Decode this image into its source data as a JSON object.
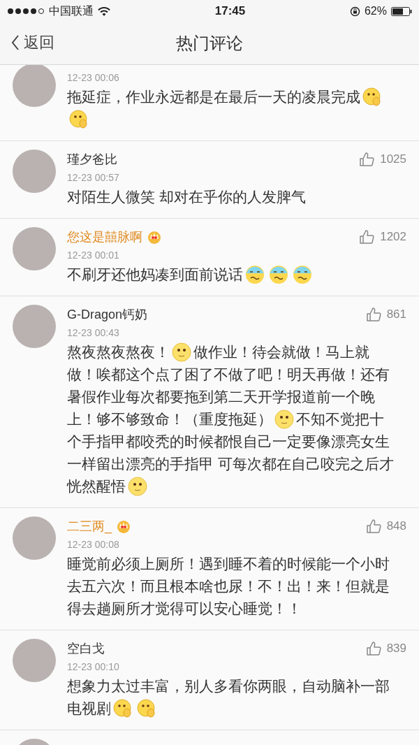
{
  "status_bar": {
    "carrier": "中国联通",
    "time": "17:45",
    "battery": "62%"
  },
  "nav": {
    "back": "返回",
    "title": "热门评论"
  },
  "comments": [
    {
      "time": "12-23 00:06",
      "lines": [
        [
          {
            "kind": "text",
            "text": "拖延症，作业永远都是在最后一天的凌晨完成"
          },
          {
            "kind": "covermouth"
          }
        ],
        [
          {
            "kind": "covermouth"
          }
        ]
      ]
    },
    {
      "name": "瑾夕爸比",
      "vip": false,
      "likes": "1025",
      "time": "12-23 00:57",
      "lines": [
        [
          {
            "kind": "text",
            "text": "对陌生人微笑 却对在乎你的人发脾气"
          }
        ]
      ]
    },
    {
      "name": "您这是囍脉啊",
      "vip": true,
      "likes": "1202",
      "time": "12-23 00:01",
      "lines": [
        [
          {
            "kind": "text",
            "text": "不刷牙还他妈凑到面前说话"
          },
          {
            "kind": "sweat"
          },
          {
            "kind": "sweat"
          },
          {
            "kind": "sweat"
          }
        ]
      ]
    },
    {
      "name": "G-Dragon钙奶",
      "vip": false,
      "likes": "861",
      "time": "12-23 00:43",
      "lines": [
        [
          {
            "kind": "text",
            "text": "熬夜熬夜熬夜！"
          },
          {
            "kind": "smile"
          },
          {
            "kind": "text",
            "text": "做作业！待会就做！马上就"
          }
        ],
        [
          {
            "kind": "text",
            "text": "做！唉都这个点了困了不做了吧！明天再做！还有"
          }
        ],
        [
          {
            "kind": "text",
            "text": "暑假作业每次都要拖到第二天开学报道前一个晚"
          }
        ],
        [
          {
            "kind": "text",
            "text": "上！够不够致命！（重度拖延）"
          },
          {
            "kind": "smile"
          },
          {
            "kind": "text",
            "text": "不知不觉把十"
          }
        ],
        [
          {
            "kind": "text",
            "text": "个手指甲都咬秃的时候都恨自己一定要像漂亮女生"
          }
        ],
        [
          {
            "kind": "text",
            "text": "一样留出漂亮的手指甲 可每次都在自己咬完之后才"
          }
        ],
        [
          {
            "kind": "text",
            "text": "恍然醒悟"
          },
          {
            "kind": "smile"
          }
        ]
      ]
    },
    {
      "name": "二三两_",
      "vip": true,
      "likes": "848",
      "time": "12-23 00:08",
      "lines": [
        [
          {
            "kind": "text",
            "text": "睡觉前必须上厕所！遇到睡不着的时候能一个小时"
          }
        ],
        [
          {
            "kind": "text",
            "text": "去五六次！而且根本啥也尿！不！出！来！但就是"
          }
        ],
        [
          {
            "kind": "text",
            "text": "得去趟厕所才觉得可以安心睡觉！！"
          }
        ]
      ]
    },
    {
      "name": "空白戈",
      "vip": false,
      "likes": "839",
      "time": "12-23 00:10",
      "lines": [
        [
          {
            "kind": "text",
            "text": "想象力太过丰富，别人多看你两眼，自动脑补一部"
          }
        ],
        [
          {
            "kind": "text",
            "text": "电视剧"
          },
          {
            "kind": "covermouth"
          },
          {
            "kind": "covermouth"
          }
        ]
      ]
    }
  ]
}
